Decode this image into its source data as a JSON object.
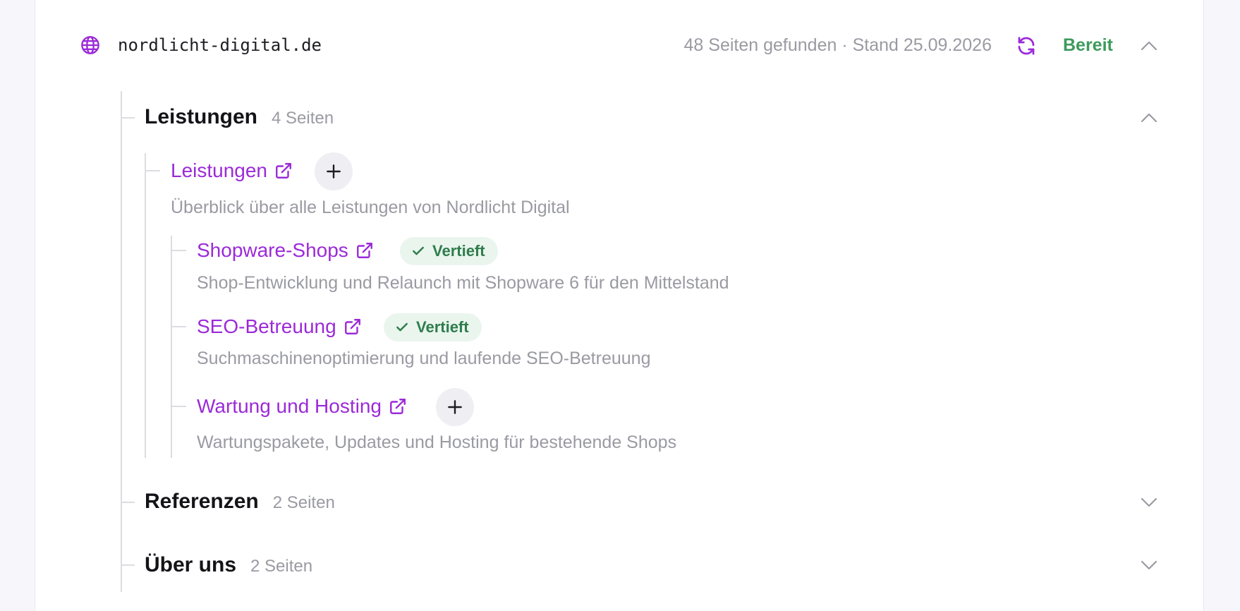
{
  "header": {
    "domain": "nordlicht-digital.de",
    "stats": "48 Seiten gefunden · Stand 25.09.2026",
    "status": "Bereit",
    "accent": "#9b2ad8",
    "status_color": "#3d9a5c"
  },
  "sections": [
    {
      "title": "Leistungen",
      "count": "4 Seiten",
      "expanded": true,
      "parent": {
        "label": "Leistungen",
        "description": "Überblick über alle Leistungen von Nordlicht Digital"
      },
      "children": [
        {
          "label": "Shopware-Shops",
          "badge": "Vertieft",
          "description": "Shop-Entwicklung und Relaunch mit Shopware 6 für den Mittelstand"
        },
        {
          "label": "SEO-Betreuung",
          "badge": "Vertieft",
          "description": "Suchmaschinenoptimierung und laufende SEO-Betreuung"
        },
        {
          "label": "Wartung und Hosting",
          "badge": null,
          "description": "Wartungspakete, Updates und Hosting für bestehende Shops"
        }
      ]
    },
    {
      "title": "Referenzen",
      "count": "2 Seiten",
      "expanded": false
    },
    {
      "title": "Über uns",
      "count": "2 Seiten",
      "expanded": false
    }
  ],
  "icons": {
    "domain": "globe-icon",
    "refresh": "refresh-icon",
    "external": "external-link-icon",
    "add": "plus-icon",
    "check": "check-icon",
    "collapse": "chevron-up-icon",
    "expand": "chevron-down-icon"
  }
}
